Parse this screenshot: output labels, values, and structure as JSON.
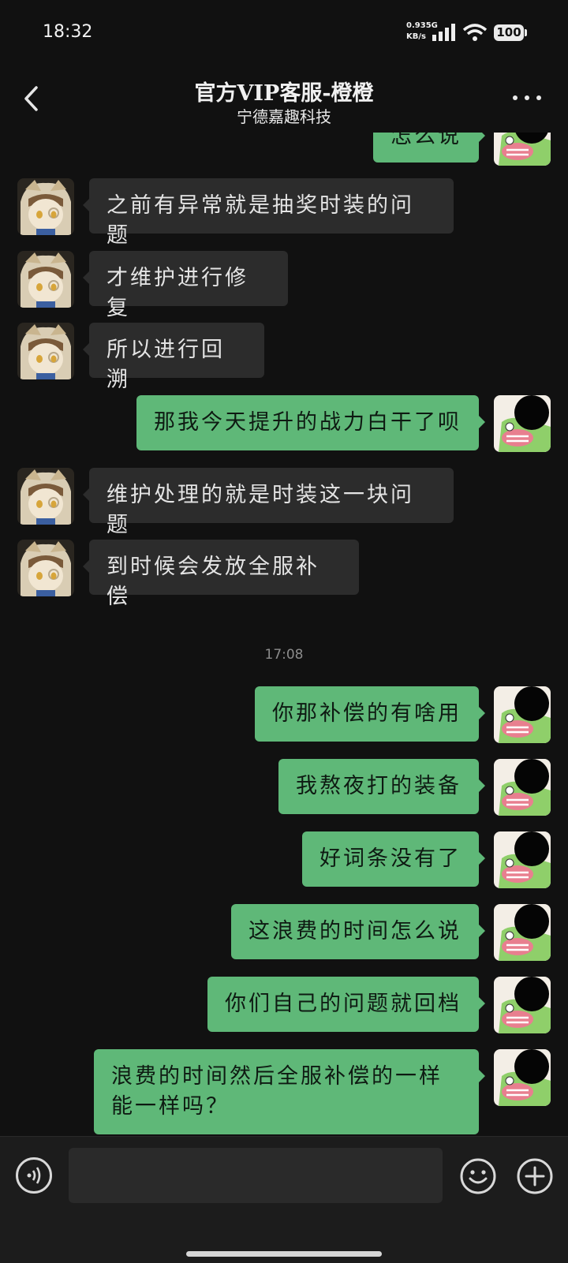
{
  "status_bar": {
    "time": "18:32",
    "net_speed_value": "0.93",
    "net_type": "5G",
    "net_speed_unit": "KB/s",
    "battery": "100"
  },
  "header": {
    "title": "官方VIP客服-橙橙",
    "subtitle": "宁德嘉趣科技"
  },
  "messages": [
    {
      "side": "out",
      "text": "怎么说"
    },
    {
      "side": "in",
      "text": "之前有异常就是抽奖时装的问题"
    },
    {
      "side": "in",
      "text": "才维护进行修复"
    },
    {
      "side": "in",
      "text": "所以进行回溯"
    },
    {
      "side": "out",
      "text": "那我今天提升的战力白干了呗"
    },
    {
      "side": "in",
      "text": "维护处理的就是时装这一块问题"
    },
    {
      "side": "in",
      "text": "到时候会发放全服补偿"
    },
    {
      "side": "out",
      "text": "你那补偿的有啥用"
    },
    {
      "side": "out",
      "text": "我熬夜打的装备"
    },
    {
      "side": "out",
      "text": "好词条没有了"
    },
    {
      "side": "out",
      "text": "这浪费的时间怎么说"
    },
    {
      "side": "out",
      "text": "你们自己的问题就回档"
    },
    {
      "side": "out",
      "text": "浪费的时间然后全服补偿的一样能一样吗？"
    }
  ],
  "time_separator": "17:08",
  "colors": {
    "background": "#111111",
    "incoming_bubble": "#2c2c2c",
    "outgoing_bubble": "#5fb878"
  },
  "input": {
    "placeholder": ""
  },
  "icons": {
    "back": "chevron-left-icon",
    "more": "more-dots-icon",
    "voice": "voice-icon",
    "emoji": "emoji-icon",
    "plus": "plus-icon"
  }
}
